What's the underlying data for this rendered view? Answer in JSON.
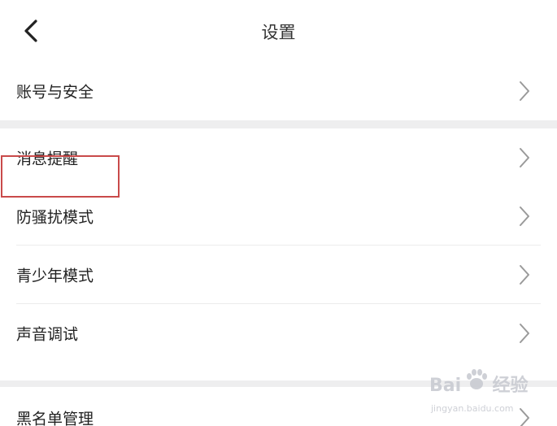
{
  "header": {
    "title": "设置",
    "back_icon": "chevron-left-icon"
  },
  "sections": [
    {
      "items": [
        {
          "label": "账号与安全",
          "icon": "chevron-right-icon"
        }
      ]
    },
    {
      "items": [
        {
          "label": "消息提醒",
          "icon": "chevron-right-icon",
          "highlighted": true
        },
        {
          "label": "防骚扰模式",
          "icon": "chevron-right-icon"
        },
        {
          "label": "青少年模式",
          "icon": "chevron-right-icon"
        },
        {
          "label": "声音调试",
          "icon": "chevron-right-icon"
        }
      ]
    },
    {
      "items": [
        {
          "label": "黑名单管理",
          "icon": "chevron-right-icon"
        }
      ]
    }
  ],
  "highlight_color": "#c94a4a",
  "watermark": {
    "logo_text": "Bai",
    "logo_text_2": "经验",
    "url": "jingyan.baidu.com"
  }
}
